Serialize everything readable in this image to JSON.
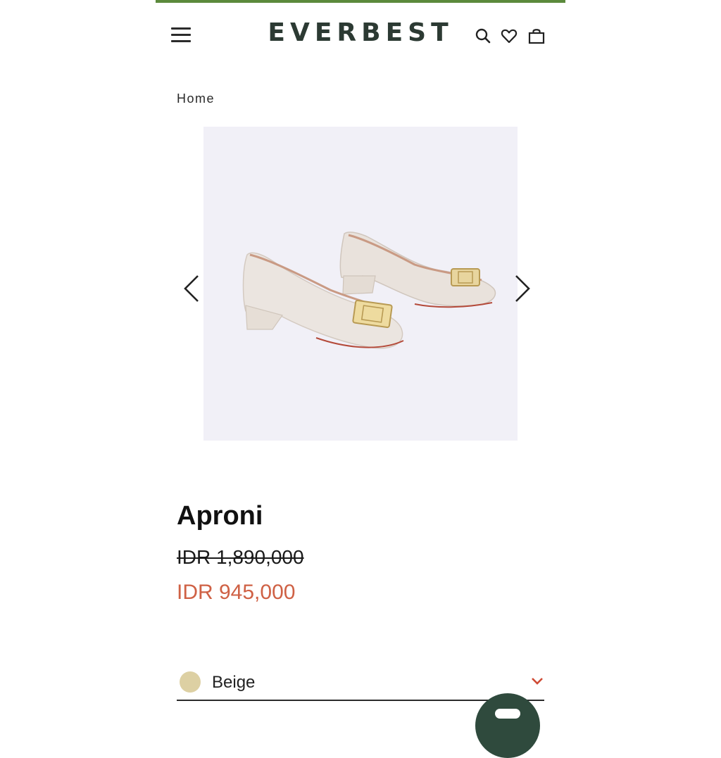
{
  "header": {
    "brand": "EVERBEST",
    "icons": [
      "menu-icon",
      "search-icon",
      "heart-icon",
      "bag-icon"
    ],
    "accent_color": "#5b8a3c"
  },
  "breadcrumb": {
    "home": "Home"
  },
  "gallery": {
    "image_alt": "product photo: pair of beige block-heel pumps with gold buckle",
    "prev_icon": "chevron-left-icon",
    "next_icon": "chevron-right-icon"
  },
  "product": {
    "title": "Aproni",
    "original_price": "IDR 1,890,000",
    "sale_price": "IDR 945,000",
    "sale_color": "#cf6145"
  },
  "variant": {
    "selected_color": "Beige",
    "swatch_color": "#ddd0a3",
    "dropdown_icon": "chevron-down-icon"
  },
  "chat": {
    "icon": "chat-icon",
    "color": "#2f4a3d"
  }
}
